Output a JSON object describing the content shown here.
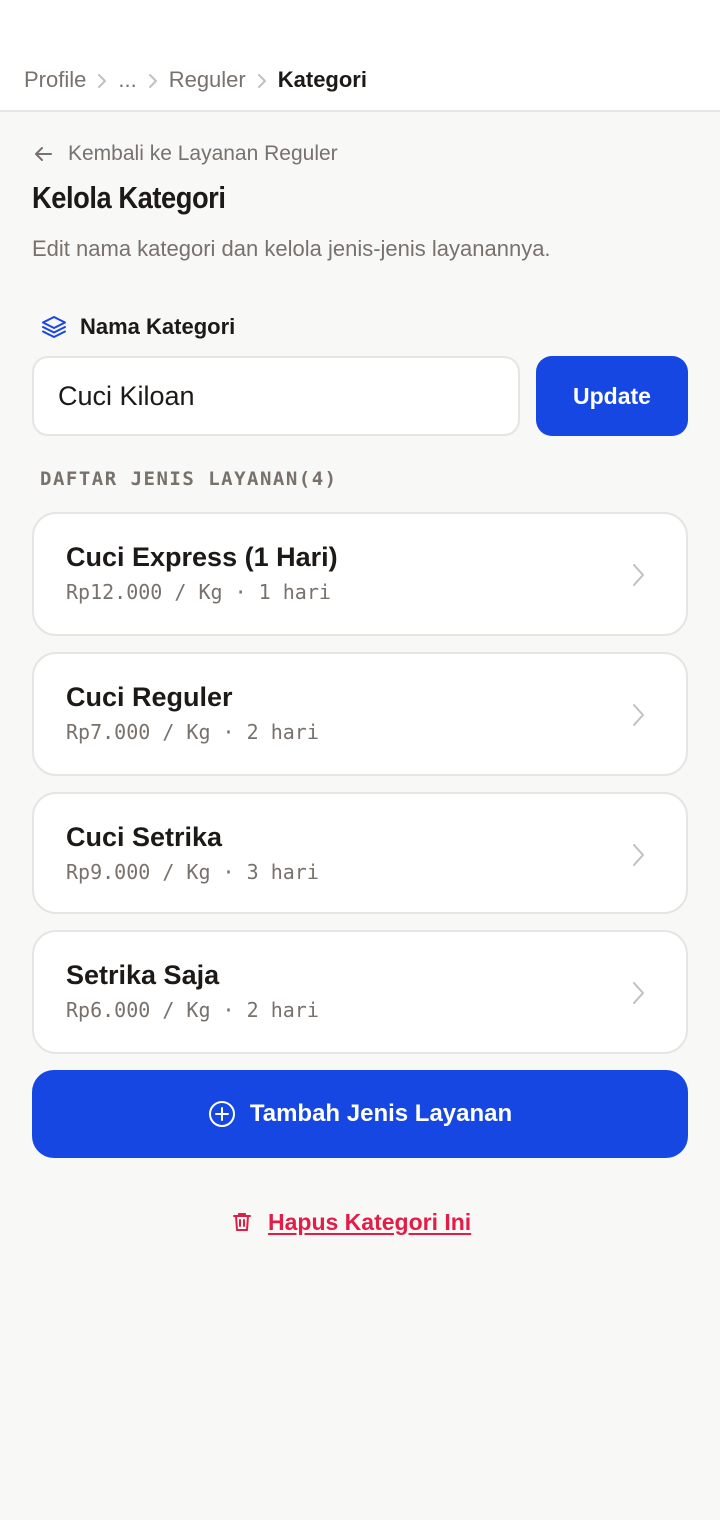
{
  "breadcrumb": {
    "items": [
      "Profile",
      "...",
      "Reguler",
      "Kategori"
    ]
  },
  "back_link": {
    "label": "Kembali ke Layanan Reguler",
    "icon": "arrow-left-icon"
  },
  "page": {
    "title": "Kelola Kategori",
    "subtitle": "Edit nama kategori dan kelola jenis-jenis layanannya."
  },
  "category_form": {
    "label": "Nama Kategori",
    "label_icon": "layers-icon",
    "input_value": "Cuci Kiloan",
    "update_label": "Update"
  },
  "services": {
    "heading": "DAFTAR JENIS LAYANAN(4)",
    "items": [
      {
        "name": "Cuci Express (1 Hari)",
        "meta": "Rp12.000 / Kg · 1 hari"
      },
      {
        "name": "Cuci Reguler",
        "meta": "Rp7.000 / Kg · 2 hari"
      },
      {
        "name": "Cuci Setrika",
        "meta": "Rp9.000 / Kg · 3 hari"
      },
      {
        "name": "Setrika Saja",
        "meta": "Rp6.000 / Kg · 2 hari"
      }
    ]
  },
  "actions": {
    "add_label": "Tambah Jenis Layanan",
    "add_icon": "plus-circle-icon",
    "delete_label": "Hapus Kategori Ini",
    "delete_icon": "trash-icon"
  },
  "colors": {
    "primary": "#1647e3",
    "danger": "#e11d48",
    "muted_text": "#78716c",
    "background": "#f8f8f7"
  }
}
